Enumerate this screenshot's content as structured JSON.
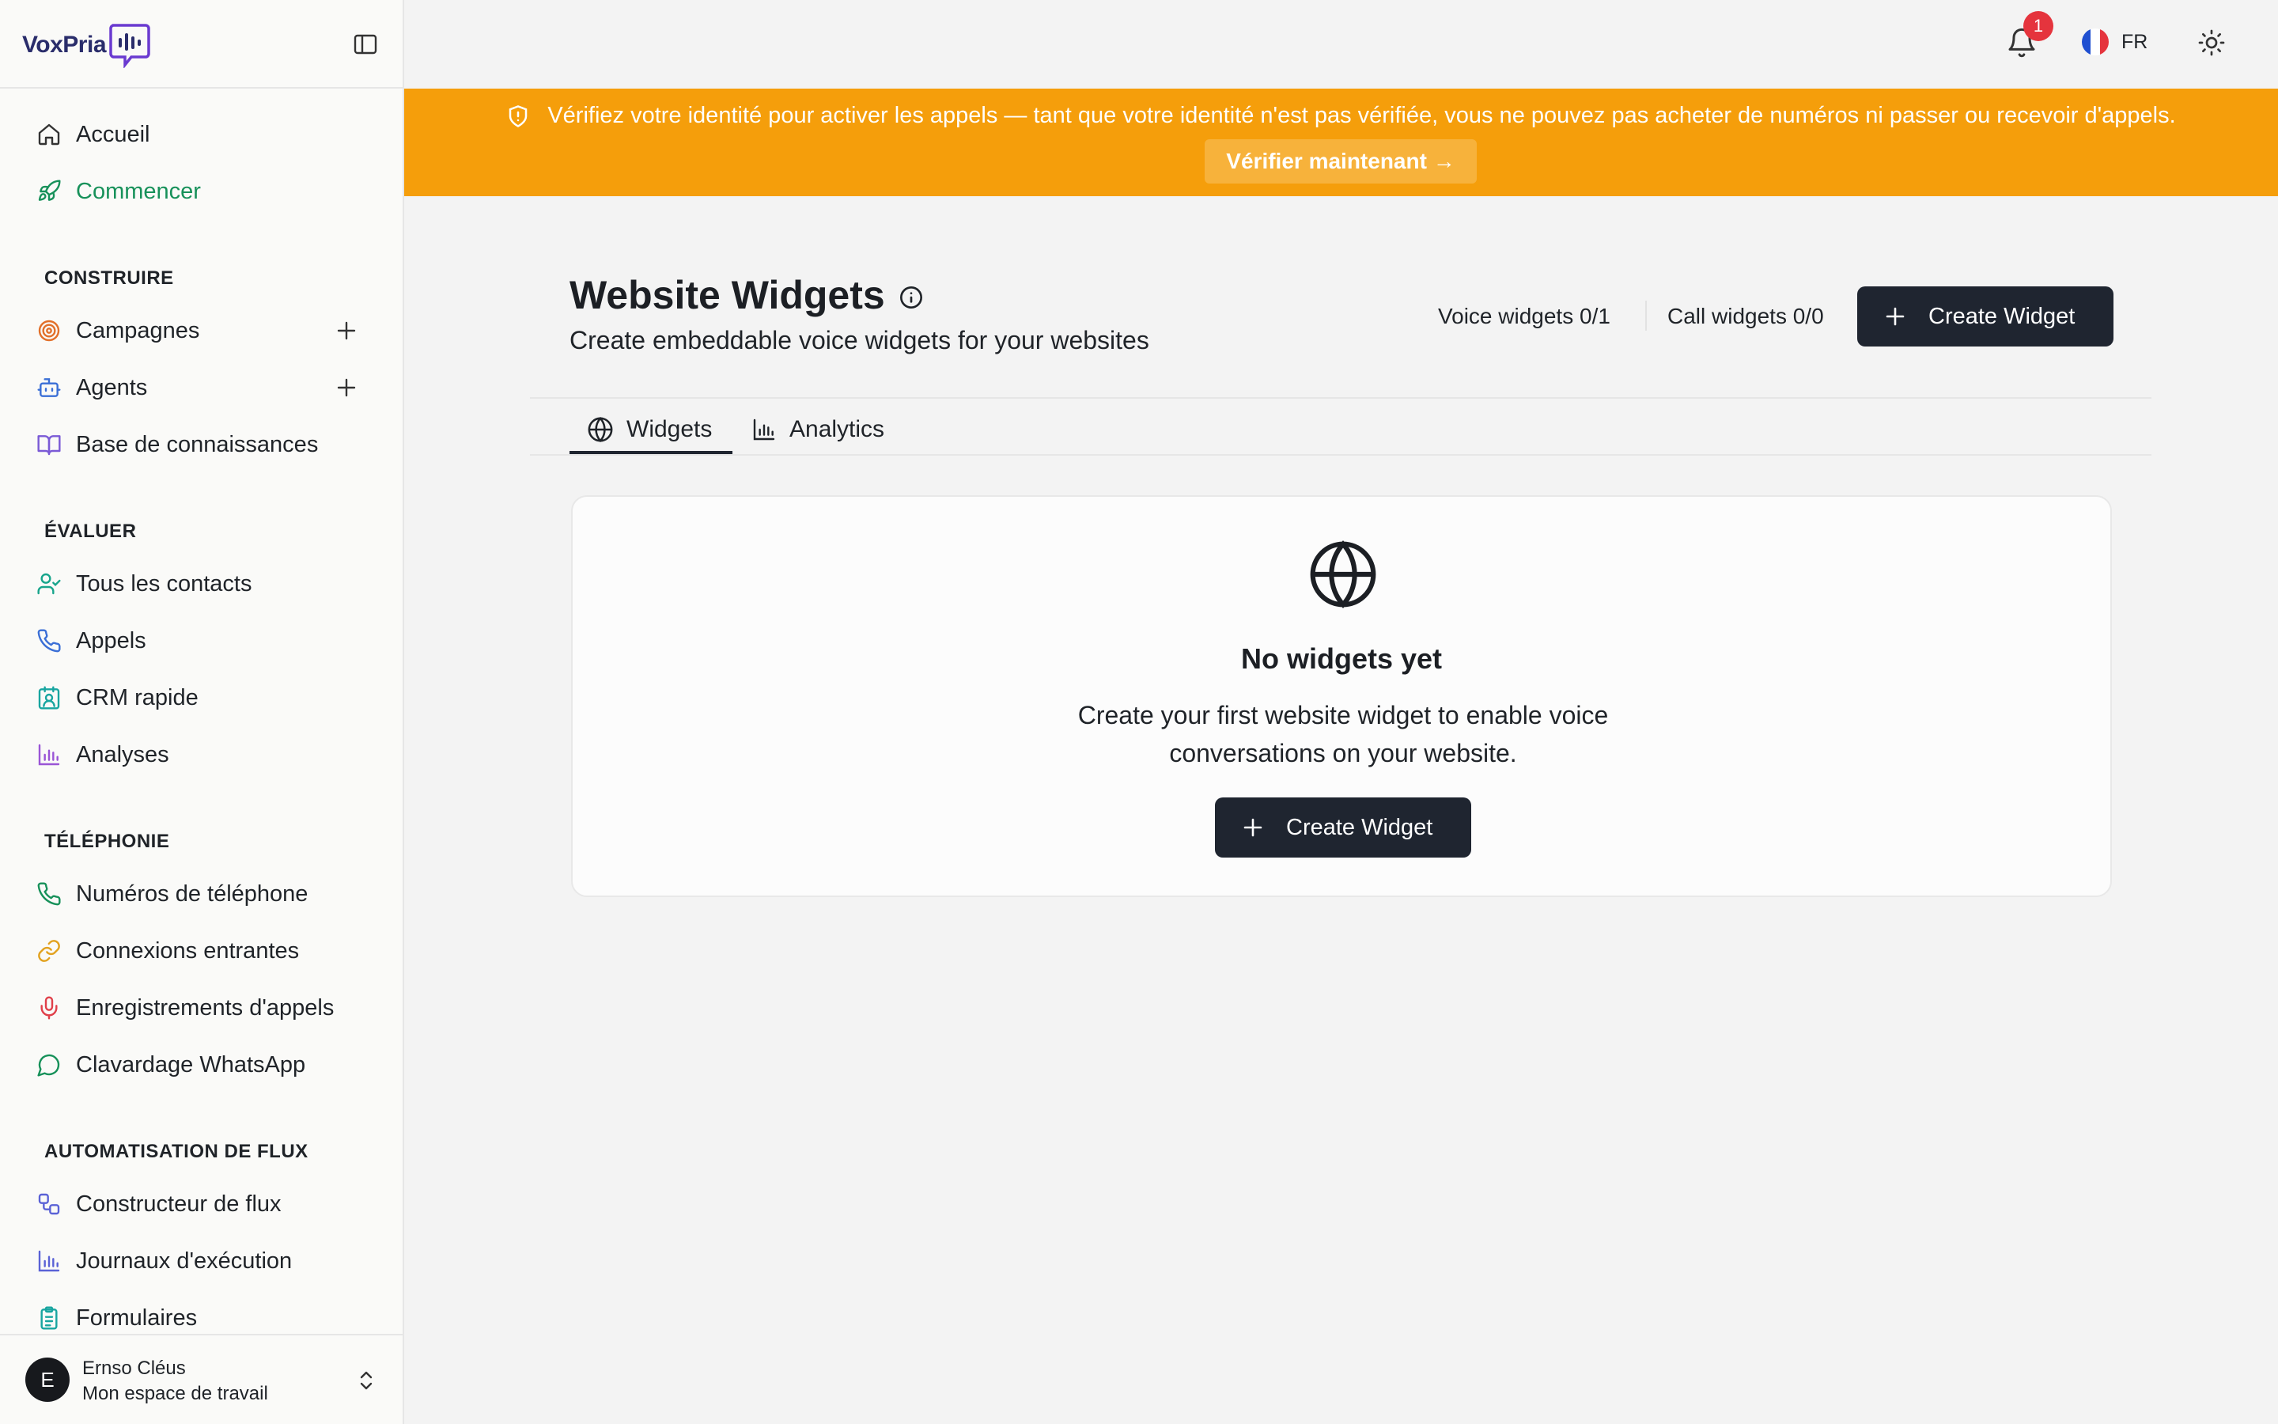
{
  "brand": {
    "name": "VoxPria"
  },
  "sidebar": {
    "top_items": [
      {
        "label": "Accueil",
        "icon": "home-icon"
      },
      {
        "label": "Commencer",
        "icon": "rocket-icon",
        "active": true
      }
    ],
    "sections": [
      {
        "title": "CONSTRUIRE",
        "items": [
          {
            "label": "Campagnes",
            "icon": "target-icon",
            "has_add": true
          },
          {
            "label": "Agents",
            "icon": "bot-icon",
            "has_add": true
          },
          {
            "label": "Base de connaissances",
            "icon": "book-icon"
          }
        ]
      },
      {
        "title": "ÉVALUER",
        "items": [
          {
            "label": "Tous les contacts",
            "icon": "user-check-icon"
          },
          {
            "label": "Appels",
            "icon": "phone-icon"
          },
          {
            "label": "CRM rapide",
            "icon": "contact-card-icon"
          },
          {
            "label": "Analyses",
            "icon": "bar-chart-icon"
          }
        ]
      },
      {
        "title": "TÉLÉPHONIE",
        "items": [
          {
            "label": "Numéros de téléphone",
            "icon": "phone-icon"
          },
          {
            "label": "Connexions entrantes",
            "icon": "link-icon"
          },
          {
            "label": "Enregistrements d'appels",
            "icon": "mic-icon"
          },
          {
            "label": "Clavardage WhatsApp",
            "icon": "chat-bubble-icon"
          }
        ]
      },
      {
        "title": "AUTOMATISATION DE FLUX",
        "items": [
          {
            "label": "Constructeur de flux",
            "icon": "workflow-icon"
          },
          {
            "label": "Journaux d'exécution",
            "icon": "bar-chart-icon"
          },
          {
            "label": "Formulaires",
            "icon": "clipboard-icon"
          }
        ]
      }
    ],
    "user": {
      "initial": "E",
      "name": "Ernso Cléus",
      "workspace": "Mon espace de travail"
    }
  },
  "topbar": {
    "notifications_count": "1",
    "language": "FR"
  },
  "banner": {
    "message": "Vérifiez votre identité pour activer les appels — tant que votre identité n'est pas vérifiée, vous ne pouvez pas acheter de numéros ni passer ou recevoir d'appels.",
    "action_label": "Vérifier maintenant →"
  },
  "page": {
    "title": "Website Widgets",
    "subtitle": "Create embeddable voice widgets for your websites",
    "voice_widgets": "Voice widgets 0/1",
    "call_widgets": "Call widgets 0/0",
    "create_label": "Create Widget",
    "tabs": [
      {
        "label": "Widgets",
        "icon": "globe-icon",
        "active": true
      },
      {
        "label": "Analytics",
        "icon": "bar-chart-icon"
      }
    ],
    "empty": {
      "title": "No widgets yet",
      "text": "Create your first website widget to enable voice conversations on your website.",
      "button": "Create Widget"
    }
  },
  "colors": {
    "accent_green": "#17915a",
    "banner_orange": "#f59e0b",
    "dark_button": "#1f2530",
    "badge_red": "#e5343d"
  }
}
